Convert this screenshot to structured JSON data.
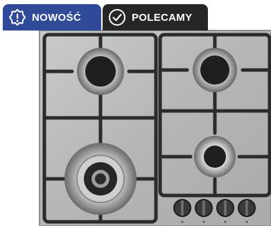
{
  "badges": {
    "new_label": "NOWOŚĆ",
    "recommended_label": "POLECAMY",
    "new_color": "#2f4a98",
    "recommended_color": "#262626",
    "new_icon": "exclamation-badge-icon",
    "recommended_icon": "check-circle-icon"
  },
  "product": {
    "image": "gas-hob-four-burners-stainless-steel"
  }
}
